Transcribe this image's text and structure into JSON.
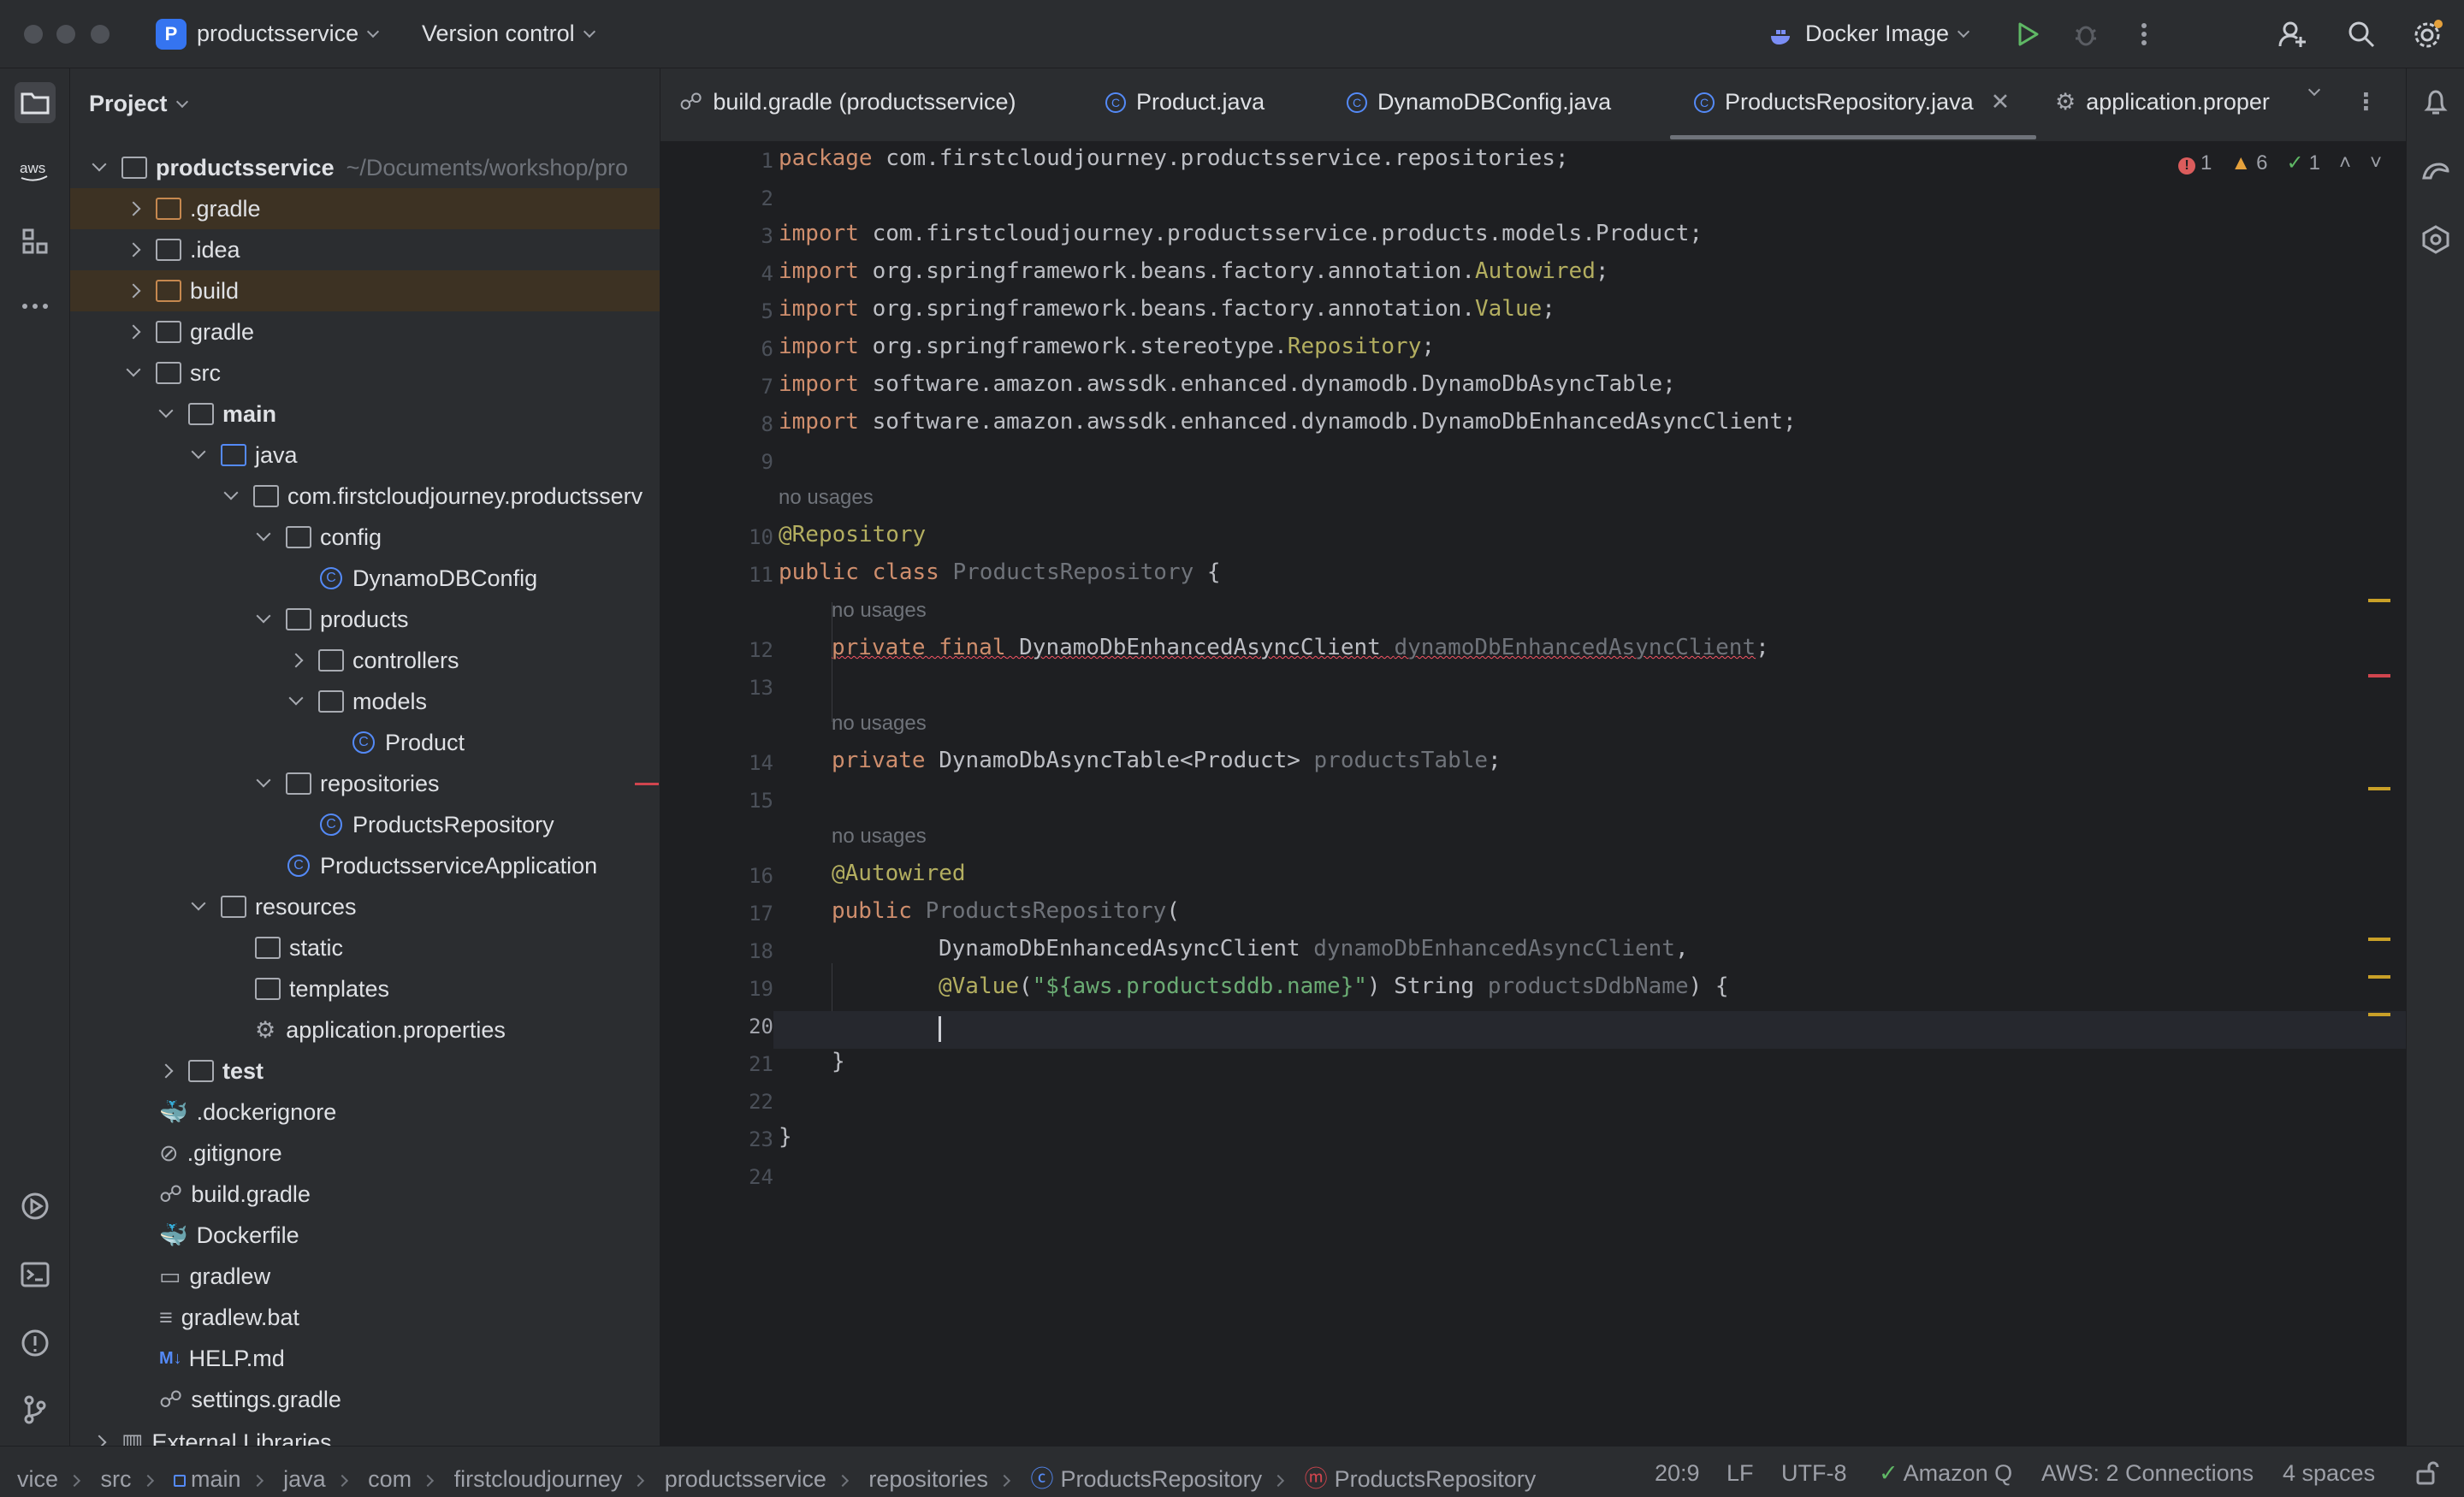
{
  "titlebar": {
    "project_initial": "P",
    "project_name": "productsservice",
    "vcs_label": "Version control",
    "run_config": "Docker Image"
  },
  "project_panel": {
    "title": "Project",
    "root_name": "productsservice",
    "root_path": "~/Documents/workshop/pro",
    "items": [
      {
        "label": ".gradle"
      },
      {
        "label": ".idea"
      },
      {
        "label": "build"
      },
      {
        "label": "gradle"
      },
      {
        "label": "src"
      },
      {
        "label": "main"
      },
      {
        "label": "java"
      },
      {
        "label": "com.firstcloudjourney.productsserv"
      },
      {
        "label": "config"
      },
      {
        "label": "DynamoDBConfig"
      },
      {
        "label": "products"
      },
      {
        "label": "controllers"
      },
      {
        "label": "models"
      },
      {
        "label": "Product"
      },
      {
        "label": "repositories"
      },
      {
        "label": "ProductsRepository"
      },
      {
        "label": "ProductsserviceApplication"
      },
      {
        "label": "resources"
      },
      {
        "label": "static"
      },
      {
        "label": "templates"
      },
      {
        "label": "application.properties"
      },
      {
        "label": "test"
      },
      {
        "label": ".dockerignore"
      },
      {
        "label": ".gitignore"
      },
      {
        "label": "build.gradle"
      },
      {
        "label": "Dockerfile"
      },
      {
        "label": "gradlew"
      },
      {
        "label": "gradlew.bat"
      },
      {
        "label": "HELP.md"
      },
      {
        "label": "settings.gradle"
      },
      {
        "label": "External Libraries"
      }
    ]
  },
  "tabs": [
    {
      "label": "build.gradle (productsservice)"
    },
    {
      "label": "Product.java"
    },
    {
      "label": "DynamoDBConfig.java"
    },
    {
      "label": "ProductsRepository.java"
    },
    {
      "label": "application.proper"
    }
  ],
  "inspections": {
    "errors": "1",
    "warnings": "6",
    "ok": "1"
  },
  "code": {
    "line_numbers": [
      "1",
      "2",
      "3",
      "4",
      "5",
      "6",
      "7",
      "8",
      "9",
      "10",
      "11",
      "12",
      "13",
      "14",
      "15",
      "16",
      "17",
      "18",
      "19",
      "20",
      "21",
      "22",
      "23",
      "24"
    ],
    "usage_hint": "no usages",
    "l1_pkg": "package",
    "l1_rest": " com.firstcloudjourney.productsservice.repositories;",
    "import_kw": "import",
    "l3": " com.firstcloudjourney.productsservice.products.models.Product;",
    "l4a": " org.springframework.beans.factory.annotation.",
    "l4b": "Autowired",
    "l5a": " org.springframework.beans.factory.annotation.",
    "l5b": "Value",
    "l6a": " org.springframework.stereotype.",
    "l6b": "Repository",
    "l7": " software.amazon.awssdk.enhanced.dynamodb.DynamoDbAsyncTable;",
    "l8": " software.amazon.awssdk.enhanced.dynamodb.DynamoDbEnhancedAsyncClient;",
    "l10": "@Repository",
    "l11a": "public class",
    "l11b": "ProductsRepository",
    "l11c": " {",
    "l12a": "private final",
    "l12b": " DynamoDbEnhancedAsyncClient ",
    "l12c": "dynamoDbEnhancedAsyncClient",
    "l14a": "private",
    "l14b": " DynamoDbAsyncTable<Product> ",
    "l14c": "productsTable",
    "l16": "@Autowired",
    "l17a": "public",
    "l17b": "ProductsRepository",
    "l17c": "(",
    "l18a": "DynamoDbEnhancedAsyncClient ",
    "l18b": "dynamoDbEnhancedAsyncClient",
    "l19a": "@Value",
    "l19b": "\"${aws.productsddb.name}\"",
    "l19c": "String ",
    "l19d": "productsDdbName",
    "close_brace": "}"
  },
  "statusbar": {
    "crumbs": [
      "vice",
      "src",
      "main",
      "java",
      "com",
      "firstcloudjourney",
      "productsservice",
      "repositories",
      "ProductsRepository",
      "ProductsRepository"
    ],
    "position": "20:9",
    "line_sep": "LF",
    "encoding": "UTF-8",
    "amazon_q": "Amazon Q",
    "aws_conn": "AWS: 2 Connections",
    "indent": "4 spaces"
  }
}
